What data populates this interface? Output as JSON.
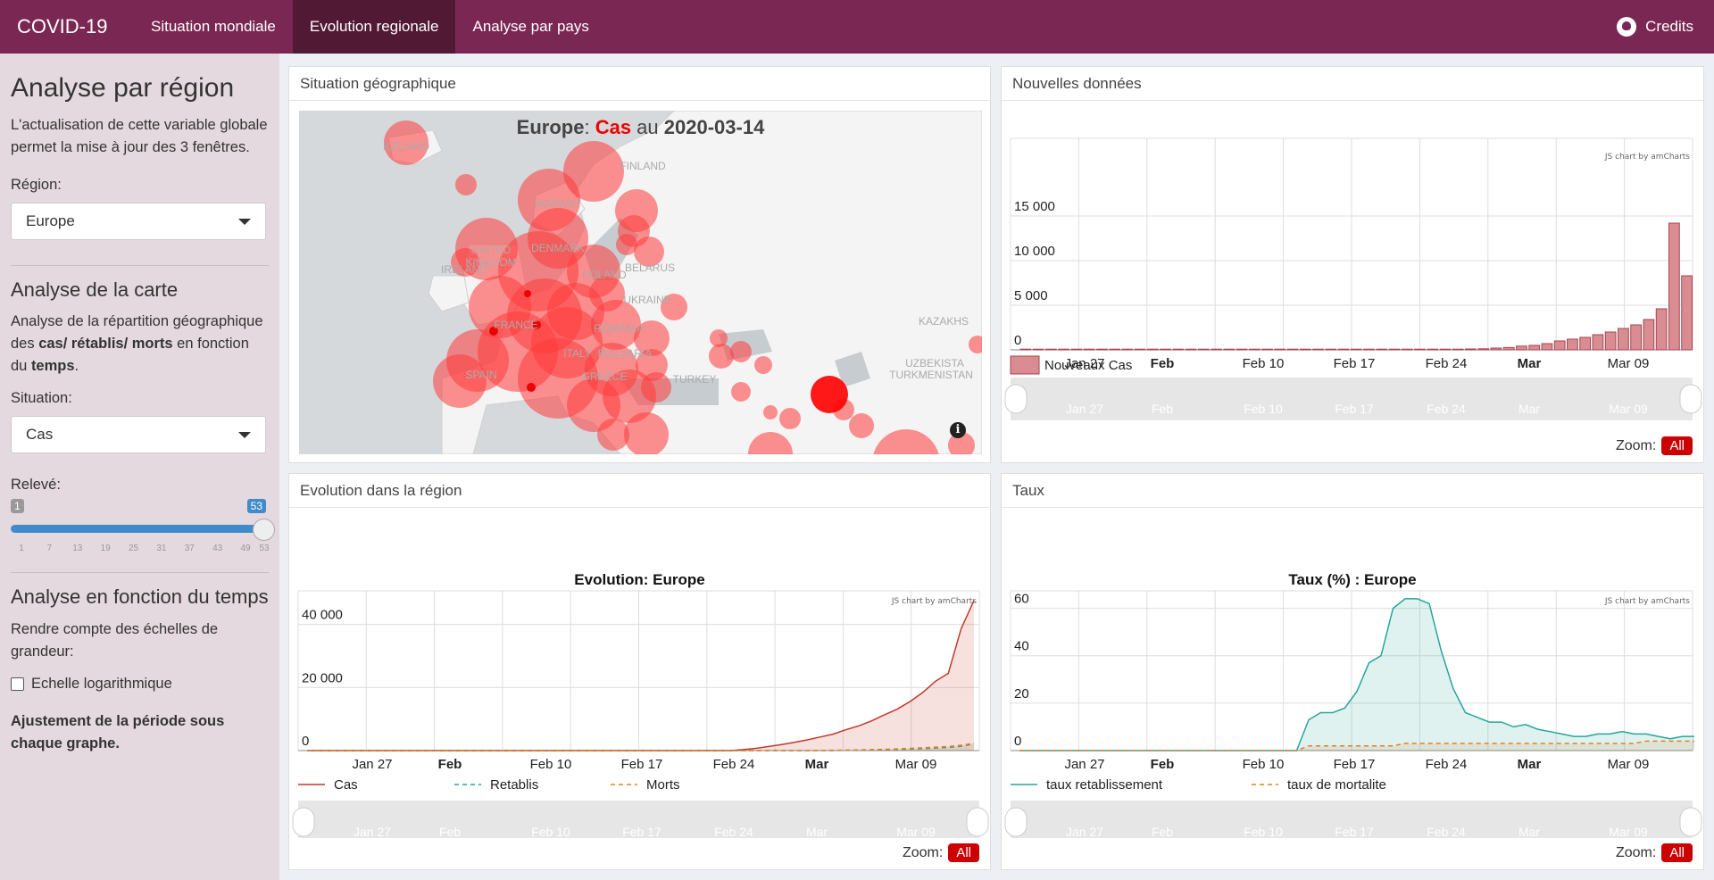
{
  "nav": {
    "brand": "COVID-19",
    "tabs": [
      {
        "label": "Situation mondiale",
        "active": false
      },
      {
        "label": "Evolution regionale",
        "active": true
      },
      {
        "label": "Analyse par pays",
        "active": false
      }
    ],
    "credits": "Credits",
    "credits_icon": "github-icon"
  },
  "sidebar": {
    "title": "Analyse par région",
    "intro": "L'actualisation de cette variable globale permet la mise à jour des 3 fenêtres.",
    "region_label": "Région:",
    "region_value": "Europe",
    "map_heading": "Analyse de la carte",
    "map_text_1": "Analyse de la répartition géographique des ",
    "map_text_bold_1": "cas/ rétablis/ morts",
    "map_text_2": " en fonction du ",
    "map_text_bold_2": "temps",
    "map_text_3": ".",
    "situation_label": "Situation:",
    "situation_value": "Cas",
    "releve_label": "Relevé:",
    "slider": {
      "min": 1,
      "max": 53,
      "value": 53,
      "ticks": [
        "1",
        "7",
        "13",
        "19",
        "25",
        "31",
        "37",
        "43",
        "49",
        "53"
      ]
    },
    "time_heading": "Analyse en fonction du temps",
    "time_text": "Rendre compte des échelles de grandeur:",
    "log_label": "Echelle logarithmique",
    "log_checked": false,
    "footer_bold": "Ajustement de la période sous chaque graphe."
  },
  "panels": {
    "map": {
      "title": "Situation géographique",
      "heading_region": "Europe",
      "heading_sep": ": ",
      "heading_var": "Cas",
      "heading_mid": " au ",
      "heading_date": "2020-03-14",
      "labels": [
        "ICELAND",
        "FINLAND",
        "NORWAY",
        "UNITED",
        "KINGDOM",
        "DENMARK",
        "IRELAND",
        "BELARUS",
        "POLAND",
        "UKRAINE",
        "KAZAKHS",
        "FRANCE",
        "ROMANIA",
        "BULGARIA",
        "ITALY",
        "SPAIN",
        "GREECE",
        "TURKEY",
        "UZBEKISTA",
        "TURKMENISTAN"
      ]
    },
    "new": {
      "title": "Nouvelles données"
    },
    "evo": {
      "title": "Evolution dans la région"
    },
    "taux": {
      "title": "Taux"
    },
    "credit": "JS chart by amCharts",
    "zoom_label": "Zoom:",
    "zoom_btn": "All"
  },
  "chart_data": [
    {
      "type": "bar",
      "title": "",
      "x_ticks": [
        "Jan 27",
        "Feb",
        "Feb 10",
        "Feb 17",
        "Feb 24",
        "Mar",
        "Mar 09"
      ],
      "y_ticks": [
        "0",
        "5 000",
        "10 000",
        "15 000"
      ],
      "ylim": [
        0,
        17500
      ],
      "series": [
        {
          "name": "Nouveaux Cas",
          "color": "#d98d93",
          "values": [
            0,
            0,
            0,
            0,
            0,
            0,
            0,
            0,
            0,
            0,
            0,
            0,
            0,
            0,
            0,
            0,
            0,
            0,
            0,
            0,
            0,
            0,
            0,
            0,
            0,
            0,
            0,
            0,
            0,
            0,
            0,
            0,
            0,
            0,
            0,
            60,
            120,
            200,
            260,
            420,
            500,
            700,
            1000,
            1200,
            1400,
            1700,
            2000,
            2400,
            2800,
            3400,
            4600,
            14200,
            8300
          ]
        }
      ],
      "legend": "bottom-left"
    },
    {
      "type": "area",
      "title": "Evolution: Europe",
      "x_ticks": [
        "Jan 27",
        "Feb",
        "Feb 10",
        "Feb 17",
        "Feb 24",
        "Mar",
        "Mar 09"
      ],
      "y_ticks": [
        "0",
        "20 000",
        "40 000"
      ],
      "ylim": [
        0,
        60000
      ],
      "series": [
        {
          "name": "Cas",
          "color": "#c0392b",
          "style": "solid",
          "values": [
            0,
            0,
            0,
            0,
            0,
            0,
            0,
            0,
            0,
            0,
            0,
            0,
            0,
            0,
            0,
            0,
            0,
            0,
            0,
            0,
            0,
            0,
            0,
            0,
            0,
            0,
            0,
            0,
            0,
            0,
            0,
            0,
            0,
            0,
            300,
            700,
            1300,
            1900,
            2600,
            3400,
            4300,
            5200,
            6600,
            7800,
            9400,
            11300,
            13100,
            15500,
            18400,
            22000,
            24500,
            38600,
            47600
          ]
        },
        {
          "name": "Retablis",
          "color": "#26a69a",
          "style": "dashed",
          "values": [
            0,
            0,
            0,
            0,
            0,
            0,
            0,
            0,
            0,
            0,
            0,
            0,
            0,
            0,
            0,
            0,
            0,
            0,
            0,
            0,
            0,
            0,
            0,
            0,
            0,
            0,
            0,
            0,
            0,
            0,
            0,
            0,
            0,
            0,
            0,
            0,
            0,
            0,
            0,
            0,
            0,
            0,
            100,
            150,
            200,
            300,
            400,
            500,
            600,
            800,
            1000,
            1400,
            2100
          ]
        },
        {
          "name": "Morts",
          "color": "#e67e22",
          "style": "dashed",
          "values": [
            0,
            0,
            0,
            0,
            0,
            0,
            0,
            0,
            0,
            0,
            0,
            0,
            0,
            0,
            0,
            0,
            0,
            0,
            0,
            0,
            0,
            0,
            0,
            0,
            0,
            0,
            0,
            0,
            0,
            0,
            0,
            0,
            0,
            0,
            0,
            0,
            0,
            0,
            0,
            0,
            60,
            100,
            150,
            230,
            320,
            420,
            550,
            700,
            900,
            1100,
            1300,
            1700,
            2300
          ]
        }
      ],
      "legend": "bottom-left"
    },
    {
      "type": "area",
      "title": "Taux (%) : Europe",
      "x_ticks": [
        "Jan 27",
        "Feb",
        "Feb 10",
        "Feb 17",
        "Feb 24",
        "Mar",
        "Mar 09"
      ],
      "y_ticks": [
        "0",
        "20",
        "40",
        "60"
      ],
      "ylim": [
        0,
        70
      ],
      "series": [
        {
          "name": "taux retablissement",
          "color": "#26a69a",
          "style": "solid",
          "values": [
            0,
            0,
            0,
            0,
            0,
            0,
            0,
            0,
            0,
            0,
            0,
            0,
            0,
            0,
            0,
            0,
            0,
            0,
            0,
            0,
            0,
            0,
            0,
            0,
            13,
            16,
            16,
            18,
            25,
            37,
            40,
            60,
            64,
            64,
            62,
            42,
            26,
            16,
            14,
            12,
            12,
            10,
            11,
            9,
            8,
            7,
            6,
            6,
            7,
            7,
            8,
            7,
            7,
            6,
            5,
            6,
            6
          ]
        },
        {
          "name": "taux de mortalite",
          "color": "#e67e22",
          "style": "dashed",
          "values": [
            0,
            0,
            0,
            0,
            0,
            0,
            0,
            0,
            0,
            0,
            0,
            0,
            0,
            0,
            0,
            0,
            0,
            0,
            0,
            0,
            0,
            0,
            0,
            0,
            2,
            2,
            2,
            2,
            2,
            2,
            2,
            2,
            3,
            3,
            3,
            3,
            3,
            3,
            3,
            3,
            3,
            3,
            3,
            3,
            3,
            3,
            3,
            3,
            3,
            3,
            3,
            3,
            4,
            4,
            4,
            4,
            4
          ]
        }
      ],
      "legend": "bottom-left"
    }
  ]
}
